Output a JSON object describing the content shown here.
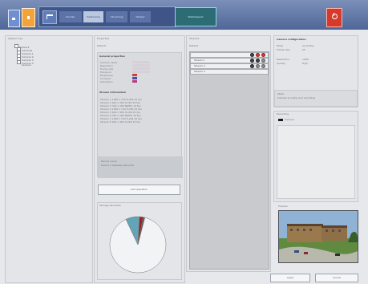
{
  "toolbar": {
    "buttons": [
      {
        "label": "Pandlar"
      },
      {
        "label": "Kalibrering"
      },
      {
        "label": "Utrustning"
      },
      {
        "label": "Vänster"
      }
    ],
    "active_tab": "Skärmlayout",
    "colors": {
      "top": "#6f86b6",
      "orange": "#f2a33a",
      "red": "#d53a2b",
      "green": "#2c6c75"
    }
  },
  "panels": {
    "tree": {
      "title": "System tree",
      "items": [
        {
          "label": "Network"
        },
        {
          "label": "Cameras"
        },
        {
          "label": "Camera 1"
        },
        {
          "label": "Camera 2"
        },
        {
          "label": "Camera 3"
        },
        {
          "label": "Camera 4"
        },
        {
          "label": "Sensors"
        }
      ]
    },
    "properties": {
      "title": "Properties",
      "subtitle": "Default",
      "section_1": "General properties",
      "rows": [
        {
          "label": "Camera name",
          "value": "Main 01"
        },
        {
          "label": "Resolution",
          "value": "1280x720"
        },
        {
          "label": "Frame rate",
          "value": "25 fps"
        },
        {
          "label": "Exposure",
          "value": "Auto"
        },
        {
          "label": "Brightness",
          "value": "50"
        },
        {
          "label": "Contrast",
          "value": "50"
        },
        {
          "label": "Saturation",
          "value": "50"
        }
      ],
      "section_2": "Stream information",
      "stream_rows": [
        {
          "label": "Stream 1",
          "value": "1280 x 720  H.264  25 fps"
        },
        {
          "label": "Stream 2",
          "value": "640 x 360  H.264  15 fps"
        },
        {
          "label": "Stream 3",
          "value": "320 x 180  MJPEG  10 fps"
        },
        {
          "label": "Stream 4",
          "value": "1280 x 720  H.264  25 fps"
        },
        {
          "label": "Stream 5",
          "value": "640 x 360  H.264  15 fps"
        },
        {
          "label": "Stream 6",
          "value": "320 x 180  MJPEG  10 fps"
        },
        {
          "label": "Stream 7",
          "value": "1280 x 720  H.264  25 fps"
        },
        {
          "label": "Stream 8",
          "value": "640 x 360  H.264  15 fps"
        }
      ],
      "bottom_label": "Device name",
      "bottom_value": "Server 1 Gateway Recorder"
    },
    "add_button": "Add operation",
    "chart": {
      "title": "Storage allocation",
      "chart_data": {
        "type": "pie",
        "values": [
          89,
          8,
          2,
          1
        ],
        "series": [
          {
            "name": "Available",
            "value": 89
          },
          {
            "name": "Video",
            "value": 8
          },
          {
            "name": "Events",
            "value": 2
          },
          {
            "name": "Other",
            "value": 1
          }
        ],
        "colors": [
          "#f2f3f5",
          "#63a4b8",
          "#9f1f1f",
          "#5c5c5c"
        ],
        "title": "Storage allocation"
      }
    },
    "streams": {
      "title": "Streams",
      "subtitle": "Default",
      "rows": [
        {
          "label": "Stream 1"
        },
        {
          "label": "Stream 2"
        },
        {
          "label": "Stream 3"
        }
      ]
    },
    "selection": {
      "title": "Camera configuration",
      "details": [
        {
          "label": "Mode",
          "value": "recording"
        },
        {
          "label": "Frame rate",
          "value": "25"
        },
        {
          "label": "Resolution",
          "value": "1280"
        },
        {
          "label": "Quality",
          "value": "High"
        }
      ],
      "info_label": "State",
      "info_value": "Camera is online and recording"
    },
    "recording": {
      "title": "Recording",
      "item": "Camera"
    },
    "preview": {
      "title": "Preview"
    }
  },
  "footer": {
    "apply": "Apply",
    "cancel": "Cancel"
  }
}
